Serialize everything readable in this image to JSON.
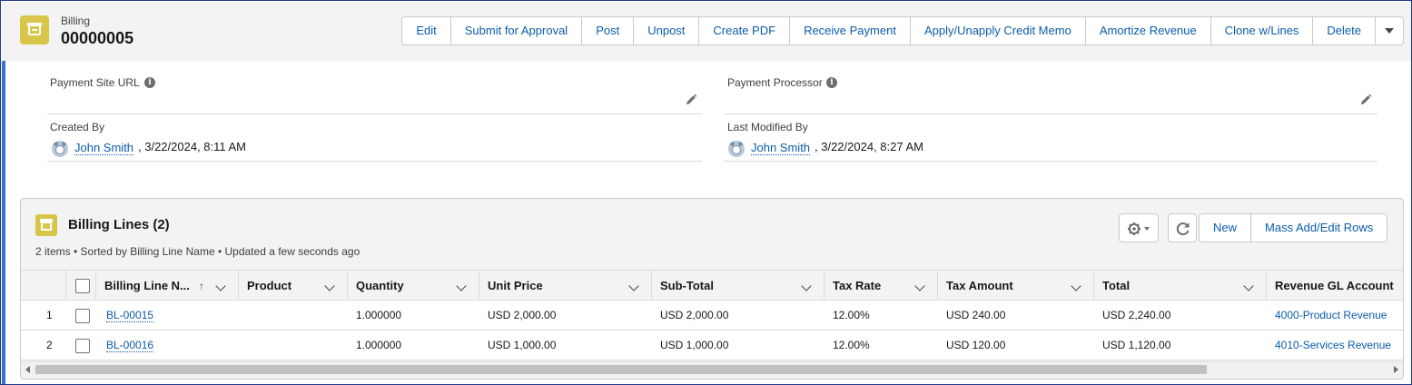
{
  "record": {
    "object_label": "Billing",
    "name": "00000005"
  },
  "actions": [
    {
      "label": "Edit"
    },
    {
      "label": "Submit for Approval"
    },
    {
      "label": "Post"
    },
    {
      "label": "Unpost"
    },
    {
      "label": "Create PDF"
    },
    {
      "label": "Receive Payment"
    },
    {
      "label": "Apply/Unapply Credit Memo"
    },
    {
      "label": "Amortize Revenue"
    },
    {
      "label": "Clone w/Lines"
    },
    {
      "label": "Delete"
    }
  ],
  "fields": {
    "payment_site_url": {
      "label": "Payment Site URL",
      "value": ""
    },
    "payment_processor": {
      "label": "Payment Processor",
      "value": ""
    },
    "created_by": {
      "label": "Created By",
      "user": "John Smith",
      "timestamp": ", 3/22/2024, 8:11 AM"
    },
    "last_modified_by": {
      "label": "Last Modified By",
      "user": "John Smith",
      "timestamp": ", 3/22/2024, 8:27 AM"
    }
  },
  "related_list": {
    "title": "Billing Lines (2)",
    "subtitle": "2 items • Sorted by Billing Line Name • Updated a few seconds ago",
    "buttons": {
      "new": "New",
      "mass_edit": "Mass Add/Edit Rows"
    },
    "columns": [
      {
        "key": "name",
        "label": "Billing Line N...",
        "sorted": "asc"
      },
      {
        "key": "product",
        "label": "Product"
      },
      {
        "key": "quantity",
        "label": "Quantity"
      },
      {
        "key": "unit_price",
        "label": "Unit Price"
      },
      {
        "key": "sub_total",
        "label": "Sub-Total"
      },
      {
        "key": "tax_rate",
        "label": "Tax Rate"
      },
      {
        "key": "tax_amount",
        "label": "Tax Amount"
      },
      {
        "key": "total",
        "label": "Total"
      },
      {
        "key": "revenue_gl",
        "label": "Revenue GL Account"
      }
    ],
    "rows": [
      {
        "num": "1",
        "name": "BL-00015",
        "product": "",
        "quantity": "1.000000",
        "unit_price": "USD 2,000.00",
        "sub_total": "USD 2,000.00",
        "tax_rate": "12.00%",
        "tax_amount": "USD 240.00",
        "total": "USD 2,240.00",
        "revenue_gl": "4000-Product Revenue"
      },
      {
        "num": "2",
        "name": "BL-00016",
        "product": "",
        "quantity": "1.000000",
        "unit_price": "USD 1,000.00",
        "sub_total": "USD 1,000.00",
        "tax_rate": "12.00%",
        "tax_amount": "USD 120.00",
        "total": "USD 1,120.00",
        "revenue_gl": "4010-Services Revenue"
      }
    ]
  },
  "colors": {
    "brand_link": "#0b5cab",
    "object_icon": "#d8c64a",
    "frame_border": "#1f3a8a"
  },
  "icons": [
    "billing-object-icon",
    "info-icon",
    "pencil-icon",
    "avatar-icon",
    "gear-icon",
    "refresh-icon",
    "chevron-down-icon",
    "sort-up-arrow-icon"
  ]
}
